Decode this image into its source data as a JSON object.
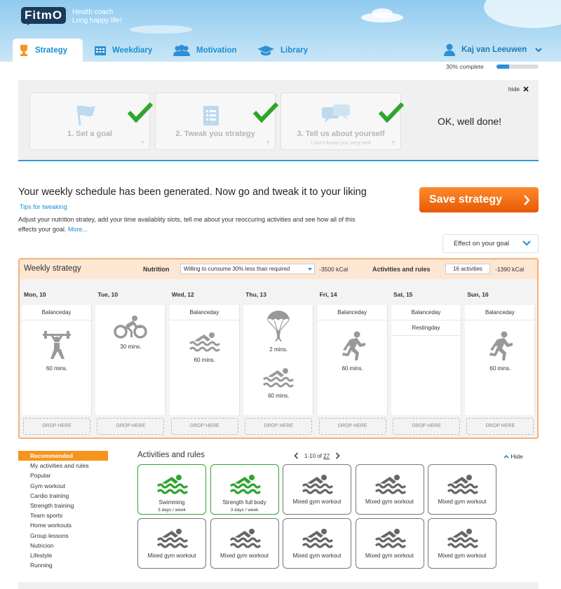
{
  "app": {
    "logo_text": "FitmO",
    "tagline_1": "Health coach",
    "tagline_2": "Long happy life!"
  },
  "tabs": [
    {
      "label": "Strategy",
      "icon": "trophy-icon",
      "active": true
    },
    {
      "label": "Weekdiary",
      "icon": "calendar-icon"
    },
    {
      "label": "Motivation",
      "icon": "people-icon"
    },
    {
      "label": "Library",
      "icon": "graduation-cap-icon"
    }
  ],
  "user": {
    "name": "Kaj van Leeuwen",
    "progress_text": "30% complete",
    "progress": 0.3
  },
  "steps": {
    "hide_label": "hide",
    "items": [
      {
        "label": "1. Set a goal",
        "sub": "",
        "q": "?",
        "icon": "flag-icon"
      },
      {
        "label": "2. Tweak you strategy",
        "sub": "",
        "q": "?",
        "icon": "list-icon"
      },
      {
        "label": "3. Tell us about yourself",
        "sub": "I don't know you very well",
        "q": "?",
        "icon": "chat-bubbles-icon"
      }
    ],
    "done_text": "OK, well done!"
  },
  "intro": {
    "headline": "Your weekly schedule has been generated. Now go and tweak it to your liking",
    "tips": "Tips for tweaking",
    "desc": "Adjust your nutrition stratey, add your time availablity slots, tell me about your reoccuring activities and see how all of this effects your goal.",
    "more": "More...",
    "save": "Save strategy",
    "effect": "Effect on your goal"
  },
  "weekly": {
    "title": "Weekly strategy",
    "nutrition_label": "Nutrition",
    "nutrition_value": "Willing to cunsume 30% less than required",
    "nutrition_kcal": "-3500 kCal",
    "activities_label": "Activities and rules",
    "activities_count": "16 activities",
    "activities_kcal": "-1390 kCal",
    "drop": "DROP HERE",
    "days": [
      {
        "name": "Mon, 10",
        "tags": [
          "Balanceday"
        ],
        "acts": [
          {
            "icon": "weightlifting-icon",
            "mins": "60 mins."
          }
        ]
      },
      {
        "name": "Tue, 10",
        "tags": [],
        "acts": [
          {
            "icon": "cycling-icon",
            "mins": "30 mins."
          }
        ]
      },
      {
        "name": "Wed, 12",
        "tags": [
          "Balanceday"
        ],
        "acts": [
          {
            "icon": "swimming-icon",
            "mins": "60 mins."
          }
        ]
      },
      {
        "name": "Thu, 13",
        "tags": [],
        "acts": [
          {
            "icon": "parachute-icon",
            "mins": "2 mins."
          },
          {
            "icon": "swimming-icon",
            "mins": "60 mins."
          }
        ]
      },
      {
        "name": "Fri, 14",
        "tags": [
          "Balanceday"
        ],
        "acts": [
          {
            "icon": "running-icon",
            "mins": "60 mins."
          }
        ]
      },
      {
        "name": "Sat, 15",
        "tags": [
          "Balanceday",
          "Restingday"
        ],
        "acts": []
      },
      {
        "name": "Sun, 16",
        "tags": [
          "Balanceday"
        ],
        "acts": [
          {
            "icon": "running-icon",
            "mins": "60 mins."
          }
        ]
      }
    ]
  },
  "categories": [
    "Recommended",
    "My activities and rules",
    "Popular",
    "Gym workout",
    "Cardio training",
    "Strength training",
    "Team sports",
    "Home workouts",
    "Group lessons",
    "Nutricion",
    "Lifestyle",
    "Running"
  ],
  "activities": {
    "title": "Activities and rules",
    "pager": "1-10 of",
    "pager_total": "27",
    "hide": "Hide",
    "cards": [
      {
        "title": "Swimming",
        "sub": "3 days / week",
        "selected": true
      },
      {
        "title": "Strength full body",
        "sub": "3 days / week",
        "selected": true
      },
      {
        "title": "Mixed gym workout",
        "sub": ""
      },
      {
        "title": "Mixed gym workout",
        "sub": ""
      },
      {
        "title": "Mixed gym workout",
        "sub": ""
      },
      {
        "title": "Mixed gym workout",
        "sub": ""
      },
      {
        "title": "Mixed gym workout",
        "sub": ""
      },
      {
        "title": "Mixed gym workout",
        "sub": ""
      },
      {
        "title": "Mixed gym workout",
        "sub": ""
      },
      {
        "title": "Mixed gym workout",
        "sub": ""
      }
    ]
  },
  "colors": {
    "accent": "#1a8fd0",
    "orange": "#f7941d",
    "green": "#2ea52e"
  }
}
